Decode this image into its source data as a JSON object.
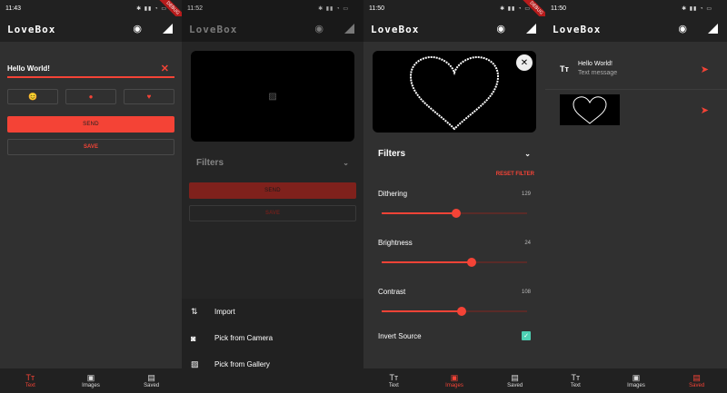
{
  "app_title": "LoveBox",
  "screens": [
    {
      "time": "11:43",
      "input_value": "Hello World!",
      "emoji": [
        "😊",
        "●",
        "♥"
      ],
      "send": "SEND",
      "save": "SAVE",
      "nav": {
        "text": "Text",
        "images": "Images",
        "saved": "Saved"
      },
      "active": "text"
    },
    {
      "time": "11:52",
      "filters": "Filters",
      "send": "SEND",
      "save": "SAVE",
      "sheet": [
        "Import",
        "Pick from Camera",
        "Pick from Gallery"
      ]
    },
    {
      "time": "11:50",
      "filters": "Filters",
      "reset": "RESET FILTER",
      "sliders": [
        {
          "label": "Dithering",
          "value": "129",
          "fraction": 0.51
        },
        {
          "label": "Brightness",
          "value": "24",
          "fraction": 0.62
        },
        {
          "label": "Contrast",
          "value": "108",
          "fraction": 0.55
        }
      ],
      "invert": "Invert Source",
      "nav": {
        "text": "Text",
        "images": "Images",
        "saved": "Saved"
      },
      "active": "images"
    },
    {
      "time": "11:50",
      "msg_title": "Hello World!",
      "msg_sub": "Text message",
      "nav": {
        "text": "Text",
        "images": "Images",
        "saved": "Saved"
      },
      "active": "saved"
    }
  ],
  "debug_banner": "DEBUG",
  "colors": {
    "accent": "#f44336",
    "appbar": "#212121",
    "background": "#303030"
  },
  "icons": [
    "eye-off-icon",
    "signal-icon",
    "text-icon",
    "image-icon",
    "save-icon",
    "send-icon",
    "import-icon",
    "camera-icon",
    "gallery-icon",
    "close-icon",
    "chevron-down-icon"
  ]
}
